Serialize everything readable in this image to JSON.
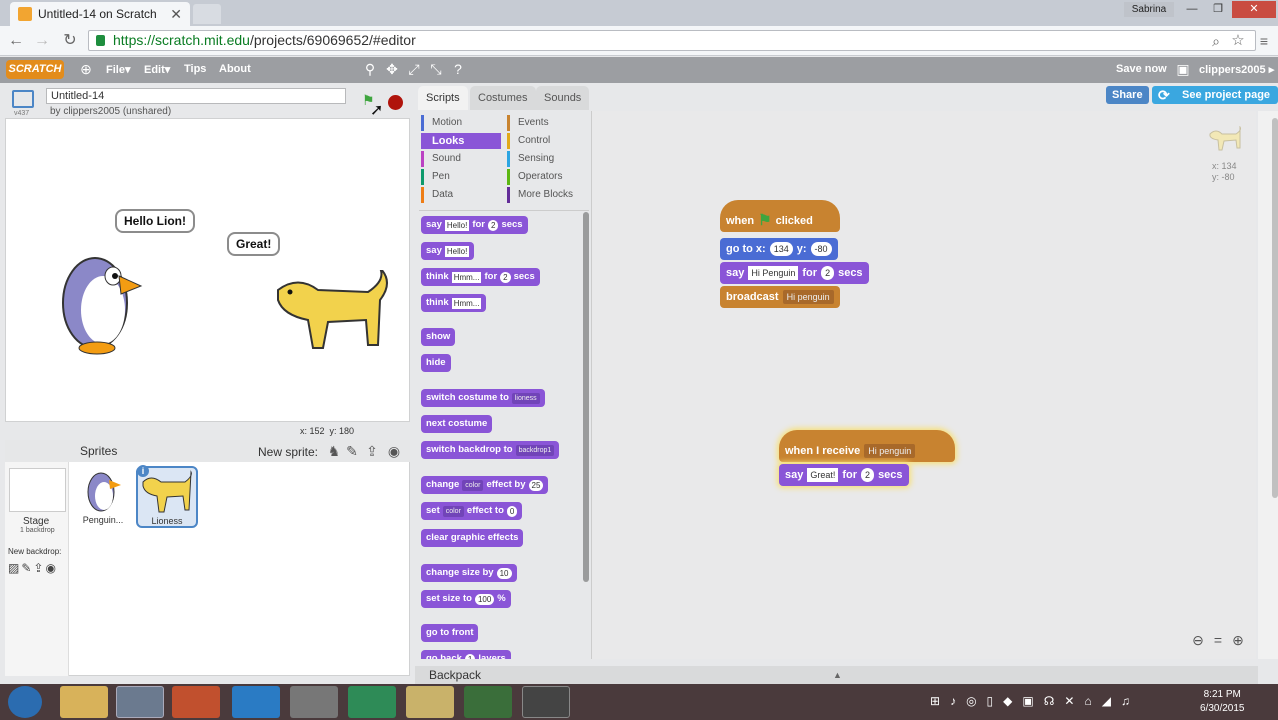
{
  "browser": {
    "tab_title": "Untitled-14 on Scratch",
    "profile_name": "Sabrina",
    "url_host": "https://scratch.mit.edu",
    "url_path": "/projects/69069652/#editor"
  },
  "scratch_menu": {
    "logo": "SCRATCH",
    "items": [
      "File▾",
      "Edit▾",
      "Tips",
      "About"
    ],
    "save_now": "Save now",
    "user": "clippers2005 ▸"
  },
  "project": {
    "title": "Untitled-14",
    "byline": "by clippers2005 (unshared)",
    "version": "v437",
    "share": "Share",
    "see_project_page": "See project page"
  },
  "stage": {
    "bubble_penguin": "Hello Lion!",
    "bubble_lion": "Great!",
    "mouse_x": "x: 152",
    "mouse_y": "y: 180"
  },
  "sprites": {
    "header": "Sprites",
    "new_sprite": "New sprite:",
    "stage_label": "Stage",
    "stage_backdrops": "1 backdrop",
    "new_backdrop": "New backdrop:",
    "items": [
      {
        "name": "Penguin..."
      },
      {
        "name": "Lioness",
        "selected": true
      }
    ]
  },
  "tabs": [
    "Scripts",
    "Costumes",
    "Sounds"
  ],
  "categories": {
    "left": [
      {
        "label": "Motion",
        "color": "#4a6cd4"
      },
      {
        "label": "Looks",
        "color": "#8a55d7",
        "selected": true
      },
      {
        "label": "Sound",
        "color": "#bb42c3"
      },
      {
        "label": "Pen",
        "color": "#0e9a6c"
      },
      {
        "label": "Data",
        "color": "#ee7d16"
      }
    ],
    "right": [
      {
        "label": "Events",
        "color": "#c88330"
      },
      {
        "label": "Control",
        "color": "#e1a91a"
      },
      {
        "label": "Sensing",
        "color": "#2ca5e2"
      },
      {
        "label": "Operators",
        "color": "#5cb712"
      },
      {
        "label": "More Blocks",
        "color": "#632d99"
      }
    ]
  },
  "palette": {
    "say_secs": {
      "a": "say",
      "v": "Hello!",
      "b": "for",
      "n": "2",
      "c": "secs"
    },
    "say": {
      "a": "say",
      "v": "Hello!"
    },
    "think_secs": {
      "a": "think",
      "v": "Hmm...",
      "b": "for",
      "n": "2",
      "c": "secs"
    },
    "think": {
      "a": "think",
      "v": "Hmm..."
    },
    "show": "show",
    "hide": "hide",
    "switch_costume": {
      "a": "switch costume to",
      "v": "lioness"
    },
    "next_costume": "next costume",
    "switch_backdrop": {
      "a": "switch backdrop to",
      "v": "backdrop1"
    },
    "change_effect": {
      "a": "change",
      "d": "color",
      "b": "effect by",
      "n": "25"
    },
    "set_effect": {
      "a": "set",
      "d": "color",
      "b": "effect to",
      "n": "0"
    },
    "clear_effects": "clear graphic effects",
    "change_size": {
      "a": "change size by",
      "n": "10"
    },
    "set_size": {
      "a": "set size to",
      "n": "100",
      "b": "%"
    },
    "go_front": "go to front",
    "go_back": {
      "a": "go back",
      "n": "1",
      "b": "layers"
    }
  },
  "script1": {
    "hat_a": "when",
    "hat_b": "clicked",
    "goto_a": "go to x:",
    "x": "134",
    "goto_b": "y:",
    "y": "-80",
    "say_a": "say",
    "say_v": "Hi Penguin",
    "say_b": "for",
    "say_n": "2",
    "say_c": "secs",
    "bc_a": "broadcast",
    "bc_v": "Hi penguin"
  },
  "script2": {
    "hat_a": "when I receive",
    "hat_v": "Hi penguin",
    "say_a": "say",
    "say_v": "Great!",
    "say_b": "for",
    "say_n": "2",
    "say_c": "secs"
  },
  "sprite_info": {
    "x": "x: 134",
    "y": "y: -80"
  },
  "backpack": "Backpack",
  "clock": {
    "time": "8:21 PM",
    "date": "6/30/2015"
  }
}
